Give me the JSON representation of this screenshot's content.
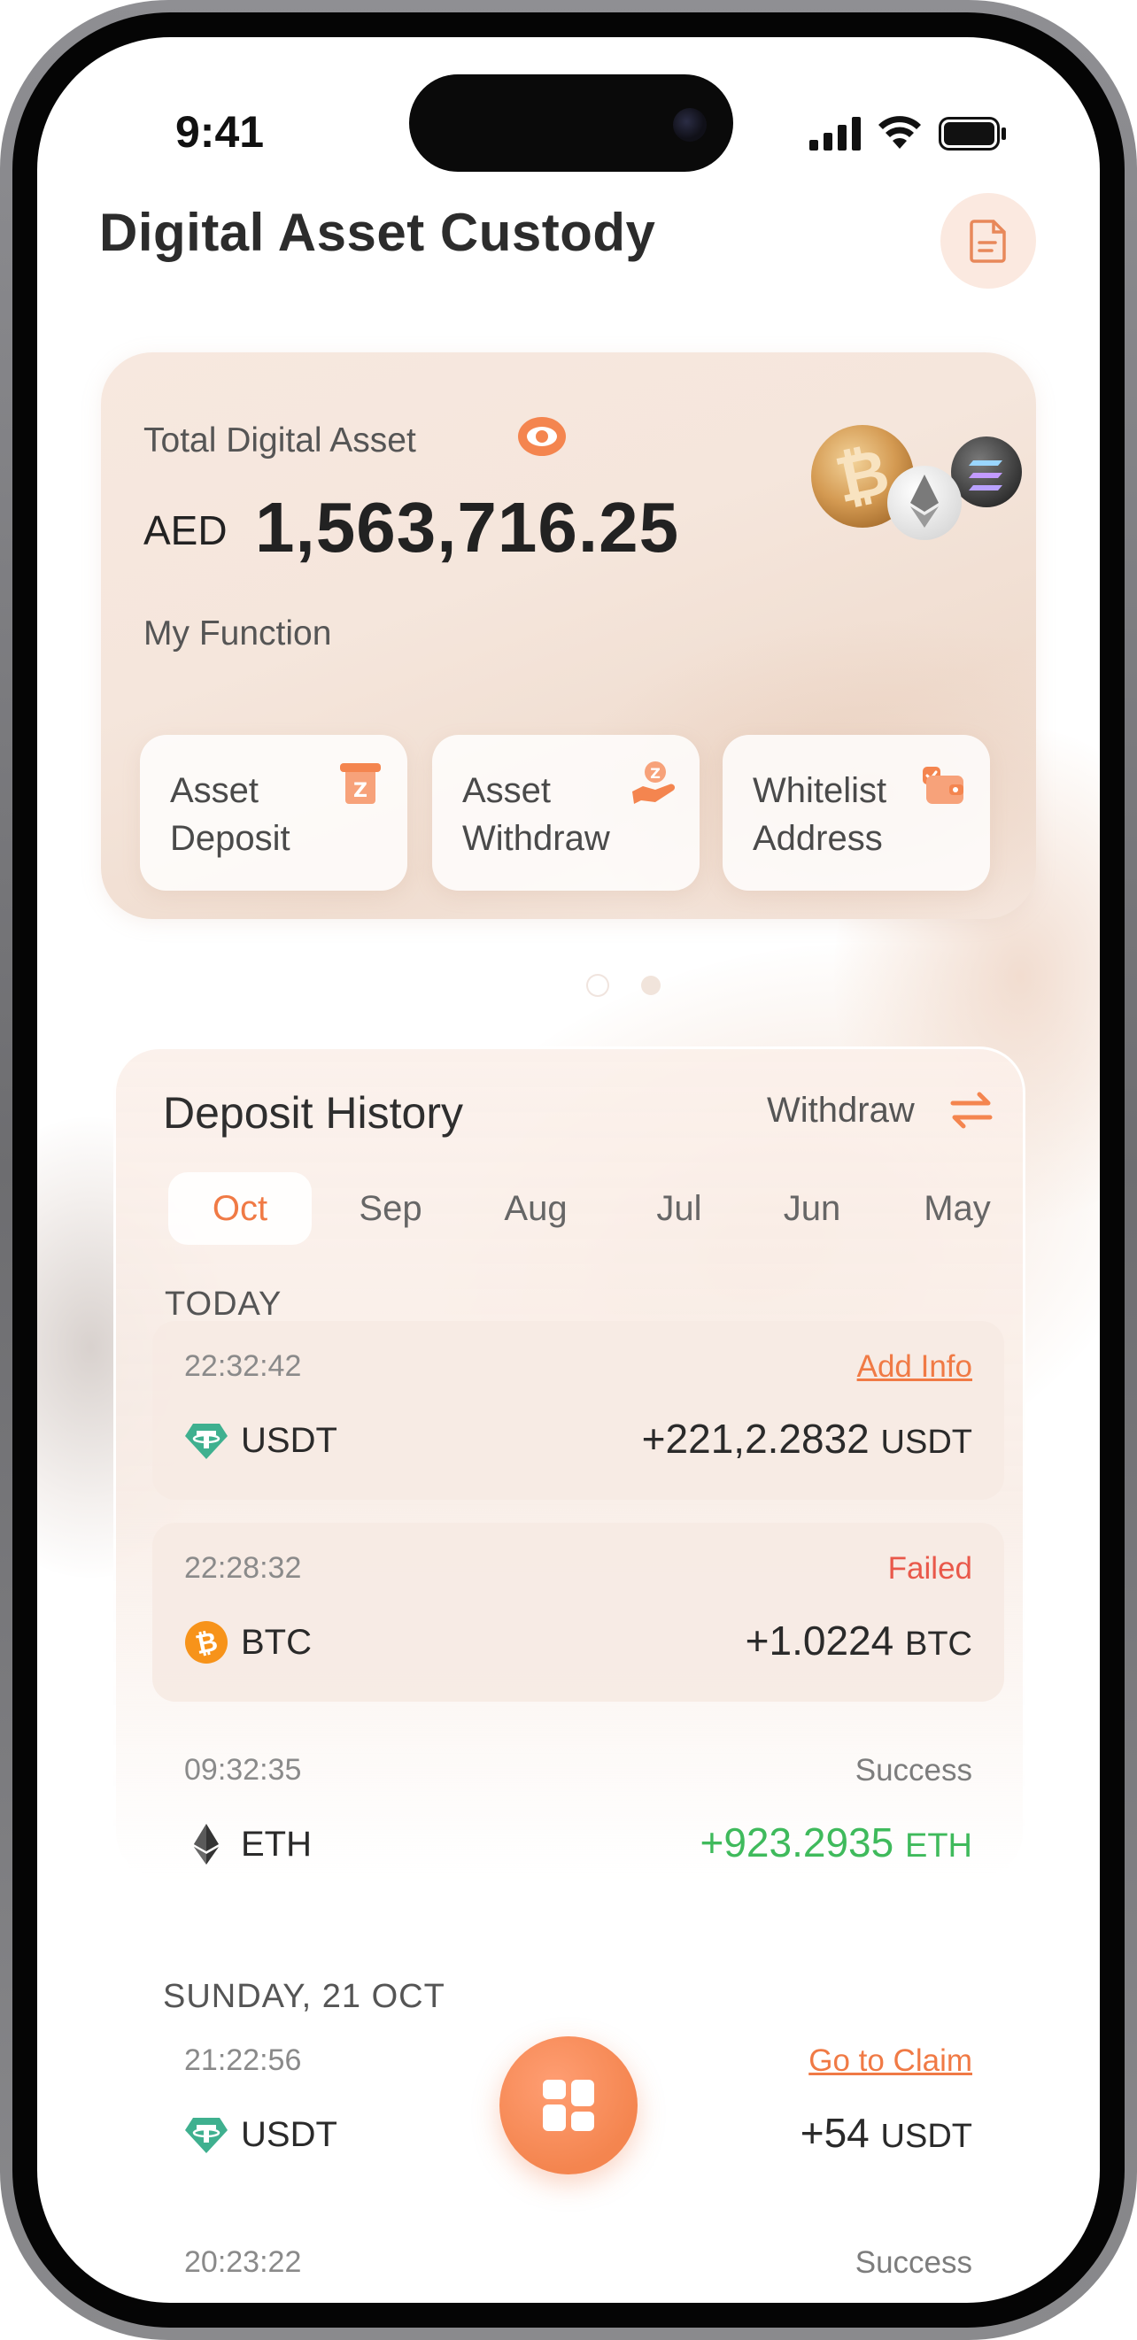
{
  "status_bar": {
    "time": "9:41"
  },
  "header": {
    "title": "Digital Asset Custody"
  },
  "asset_card": {
    "total_label": "Total Digital Asset",
    "currency": "AED",
    "amount": "1,563,716.25",
    "my_function_label": "My Function",
    "functions": [
      {
        "line1": "Asset",
        "line2": "Deposit",
        "icon": "deposit-icon"
      },
      {
        "line1": "Asset",
        "line2": "Withdraw",
        "icon": "withdraw-hand-icon"
      },
      {
        "line1": "Whitelist",
        "line2": "Address",
        "icon": "wallet-icon"
      }
    ]
  },
  "pager": {
    "count": 2,
    "active": 0
  },
  "history": {
    "title": "Deposit History",
    "switch_label": "Withdraw",
    "months": [
      "Oct",
      "Sep",
      "Aug",
      "Jul",
      "Jun",
      "May"
    ],
    "active_month": "Oct",
    "sections": [
      {
        "label": "TODAY",
        "items": [
          {
            "time": "22:32:42",
            "status": "Add Info",
            "status_type": "link",
            "coin": "USDT",
            "amount": "+221,2.2832",
            "unit": "USDT"
          },
          {
            "time": "22:28:32",
            "status": "Failed",
            "status_type": "failed",
            "coin": "BTC",
            "amount": "+1.0224",
            "unit": "BTC"
          },
          {
            "time": "09:32:35",
            "status": "Success",
            "status_type": "success",
            "coin": "ETH",
            "amount": "+923.2935",
            "unit": "ETH"
          }
        ]
      },
      {
        "label": "SUNDAY, 21 OCT",
        "items": [
          {
            "time": "21:22:56",
            "status": "Go to Claim",
            "status_type": "link",
            "coin": "USDT",
            "amount": "+54",
            "unit": "USDT"
          },
          {
            "time": "20:23:22",
            "status": "Success",
            "status_type": "success"
          }
        ]
      }
    ]
  },
  "colors": {
    "accent": "#f4854f",
    "success_green": "#3fba5c",
    "failed_red": "#e9584a"
  }
}
